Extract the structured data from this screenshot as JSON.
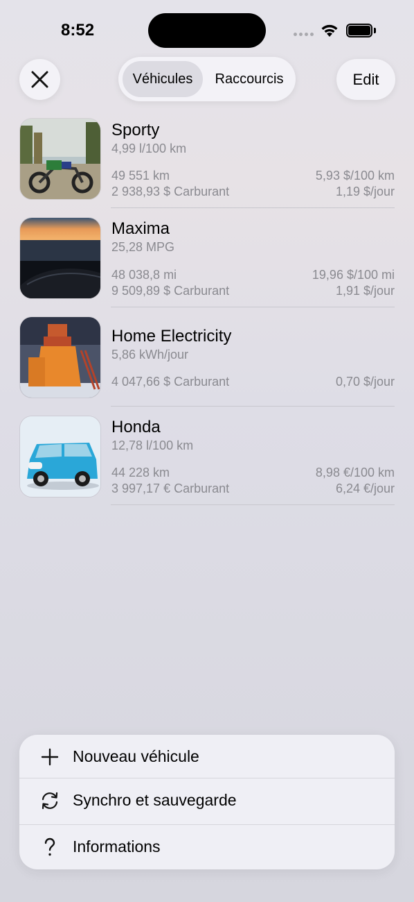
{
  "status_bar": {
    "time": "8:52"
  },
  "header": {
    "close_icon": "xmark-icon",
    "tabs": [
      {
        "label": "Véhicules",
        "selected": true
      },
      {
        "label": "Raccourcis",
        "selected": false
      }
    ],
    "edit_label": "Edit"
  },
  "vehicles": [
    {
      "name": "Sporty",
      "efficiency": "4,99 l/100 km",
      "distance": "49 551 km",
      "cost_per_distance": "5,93 $/100 km",
      "fuel_cost": "2 938,93 $ Carburant",
      "cost_per_day": "1,19 $/jour"
    },
    {
      "name": "Maxima",
      "efficiency": "25,28 MPG",
      "distance": "48 038,8 mi",
      "cost_per_distance": "19,96 $/100 mi",
      "fuel_cost": "9 509,89 $ Carburant",
      "cost_per_day": "1,91 $/jour"
    },
    {
      "name": "Home Electricity",
      "efficiency": "5,86 kWh/jour",
      "fuel_cost": "4 047,66 $ Carburant",
      "cost_per_day": "0,70 $/jour"
    },
    {
      "name": "Honda",
      "efficiency": "12,78 l/100 km",
      "distance": "44 228 km",
      "cost_per_distance": "8,98 €/100 km",
      "fuel_cost": "3 997,17 € Carburant",
      "cost_per_day": "6,24 €/jour"
    }
  ],
  "menu": {
    "items": [
      {
        "label": "Nouveau véhicule",
        "icon": "plus-icon"
      },
      {
        "label": "Synchro et sauvegarde",
        "icon": "sync-icon"
      },
      {
        "label": "Informations",
        "icon": "question-icon"
      }
    ]
  }
}
